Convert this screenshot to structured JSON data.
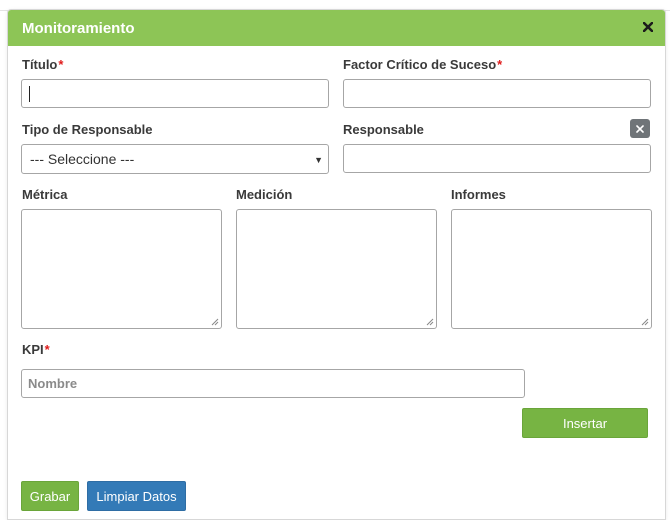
{
  "dialog": {
    "title": "Monitoramiento",
    "close_icon": "close-icon"
  },
  "form": {
    "titulo_label": "Título",
    "factor_label": "Factor Crítico de Suceso",
    "tipo_responsable_label": "Tipo de Responsable",
    "tipo_responsable_value": "--- Seleccione ---",
    "responsable_label": "Responsable",
    "metrica_label": "Métrica",
    "medicion_label": "Medición",
    "informes_label": "Informes",
    "kpi_label": "KPI",
    "kpi_placeholder": "Nombre",
    "required_mark": "*"
  },
  "buttons": {
    "insertar": "Insertar",
    "grabar": "Grabar",
    "limpiar": "Limpiar Datos"
  },
  "colors": {
    "header": "#8dc556",
    "primary_green": "#77b443",
    "primary_blue": "#337ab7",
    "required": "#e01b1b"
  }
}
